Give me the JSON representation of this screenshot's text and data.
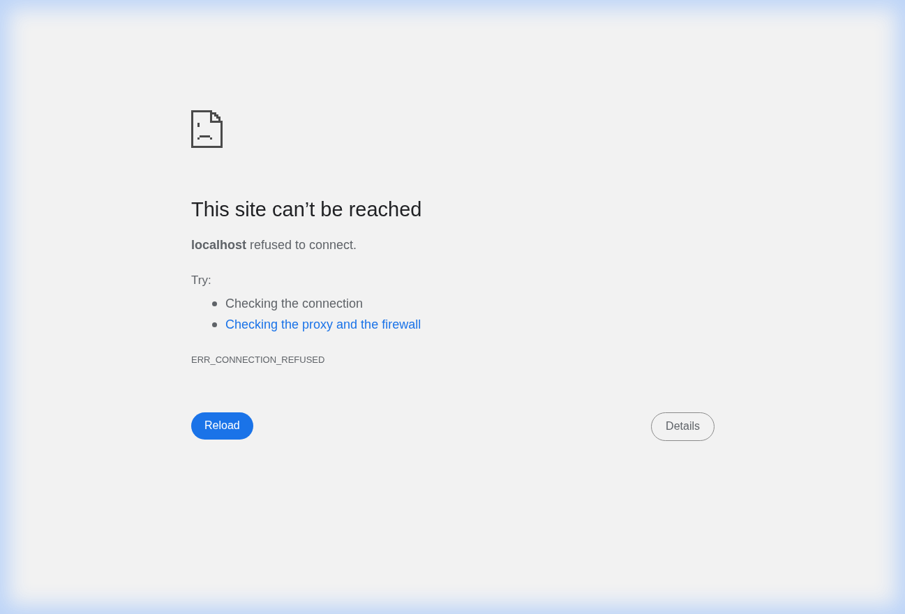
{
  "heading": "This site can’t be reached",
  "message": "**localhost** refused to connect.",
  "try_label": "Try:",
  "suggestions": [
    {
      "text": "Checking the connection",
      "kind": "text"
    },
    {
      "text": "Checking the proxy and the firewall",
      "kind": "link"
    }
  ],
  "error_code": "ERR_CONNECTION_REFUSED",
  "buttons": {
    "reload": "Reload",
    "details": "Details"
  }
}
